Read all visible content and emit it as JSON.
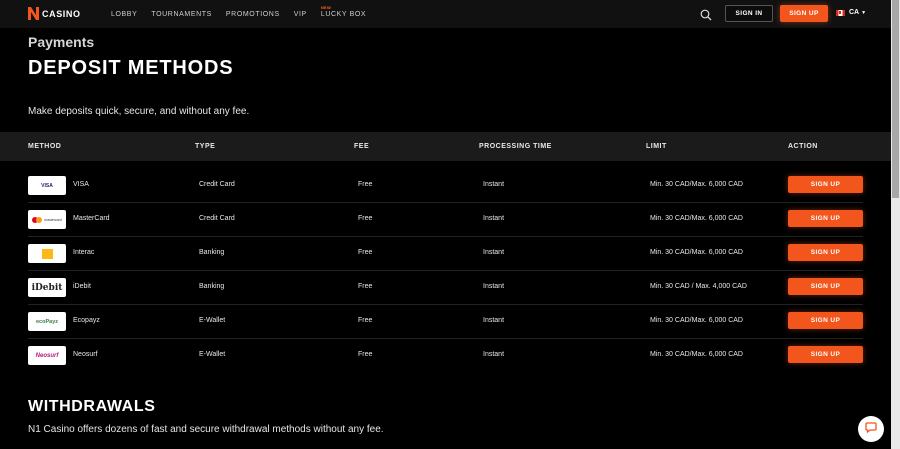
{
  "header": {
    "logo_text": "CASINO",
    "nav": [
      {
        "label": "LOBBY"
      },
      {
        "label": "TOURNAMENTS"
      },
      {
        "label": "PROMOTIONS"
      },
      {
        "label": "VIP"
      },
      {
        "label": "LUCKY BOX",
        "badge": "NEW"
      }
    ],
    "sign_in_label": "SIGN IN",
    "sign_up_label": "SIGN UP",
    "language": "CA"
  },
  "page": {
    "breadcrumb": "Payments",
    "title": "DEPOSIT METHODS",
    "subtitle": "Make deposits quick, secure, and without any fee."
  },
  "table": {
    "columns": [
      "METHOD",
      "TYPE",
      "FEE",
      "PROCESSING TIME",
      "LIMIT",
      "ACTION"
    ],
    "rows": [
      {
        "method": "VISA",
        "logo_text": "VISA",
        "type": "Credit Card",
        "fee": "Free",
        "time": "Instant",
        "limit": "Min. 30 CAD/Max. 6,000 CAD",
        "action": "SIGN UP"
      },
      {
        "method": "MasterCard",
        "logo_text": "mastercard",
        "type": "Credit Card",
        "fee": "Free",
        "time": "Instant",
        "limit": "Min. 30 CAD/Max. 6,000 CAD",
        "action": "SIGN UP"
      },
      {
        "method": "Interac",
        "logo_text": "",
        "type": "Banking",
        "fee": "Free",
        "time": "Instant",
        "limit": "Min. 30 CAD/Max. 6,000 CAD",
        "action": "SIGN UP"
      },
      {
        "method": "iDebit",
        "logo_text": "iDebit",
        "type": "Banking",
        "fee": "Free",
        "time": "Instant",
        "limit": "Min. 30 CAD / Max. 4,000 CAD",
        "action": "SIGN UP"
      },
      {
        "method": "Ecopayz",
        "logo_text": "ecoPayz",
        "type": "E-Wallet",
        "fee": "Free",
        "time": "Instant",
        "limit": "Min. 30 CAD/Max. 6,000 CAD",
        "action": "SIGN UP"
      },
      {
        "method": "Neosurf",
        "logo_text": "Neosurf",
        "type": "E-Wallet",
        "fee": "Free",
        "time": "Instant",
        "limit": "Min. 30 CAD/Max. 6,000 CAD",
        "action": "SIGN UP"
      }
    ]
  },
  "withdrawals": {
    "title": "WITHDRAWALS",
    "text": "N1 Casino offers dozens of fast and secure withdrawal methods without any fee."
  },
  "colors": {
    "accent": "#f2561d",
    "background": "#000000",
    "header_bg": "#111111",
    "table_head_bg": "#1b1b1b"
  },
  "icons": [
    "n1-logo-icon",
    "search-icon",
    "flag-icon",
    "caret-down-icon",
    "chat-icon"
  ]
}
